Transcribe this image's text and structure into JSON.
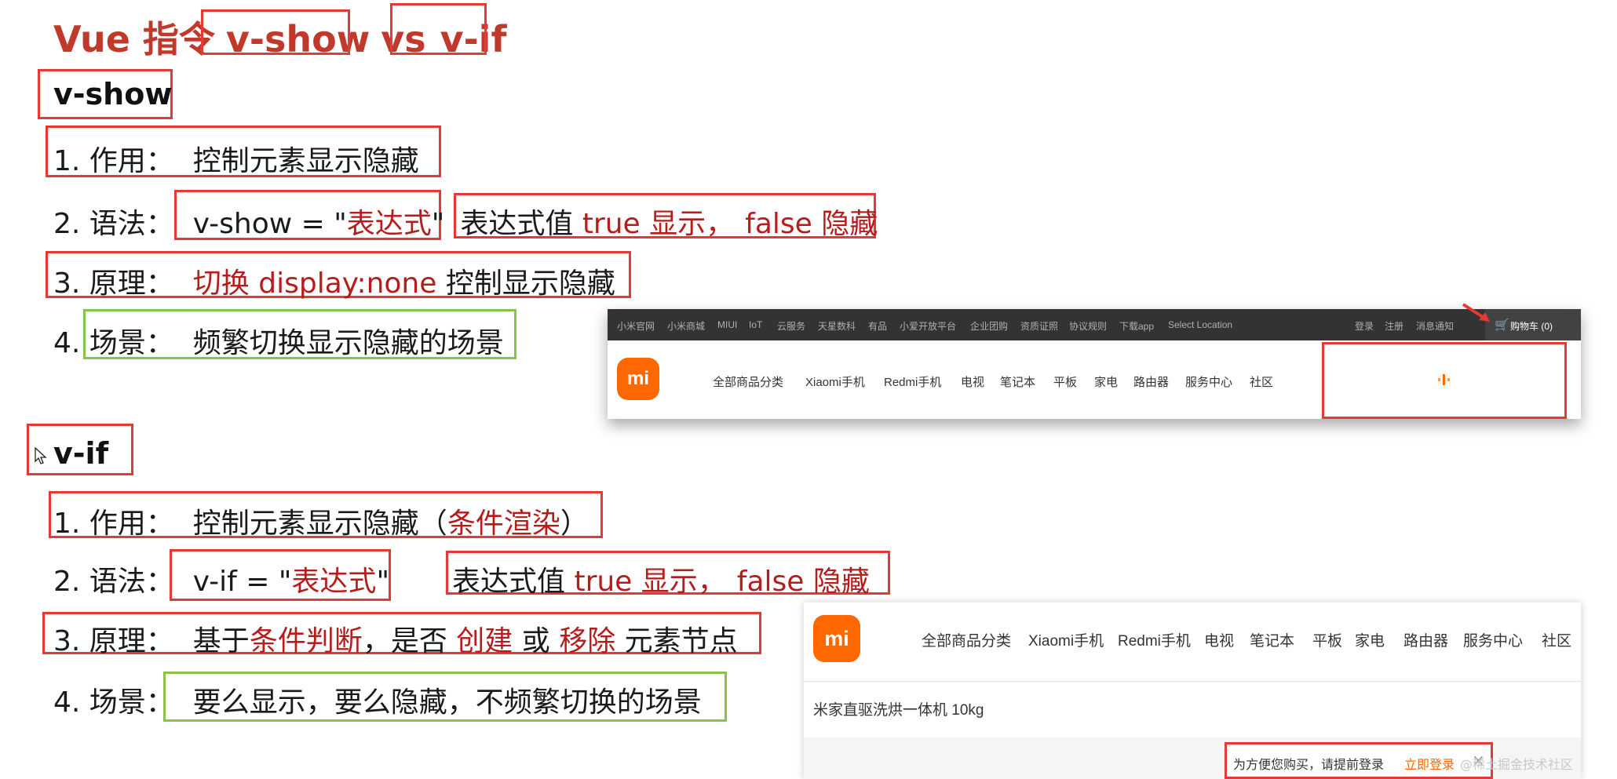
{
  "title": {
    "prefix": "Vue 指令",
    "v_show": "v-show",
    "vs": "vs",
    "v_if": "v-if"
  },
  "vshow": {
    "heading": "v-show",
    "item1": {
      "num": "1. 作用：",
      "text": "控制元素显示隐藏"
    },
    "item2": {
      "num": "2. 语法：",
      "syntax_pre": "v-show = \"",
      "syntax_expr": "表达式",
      "syntax_post": "\"",
      "val_pre": "表达式值 ",
      "val_true": "true 显示，",
      "val_false": "false 隐藏"
    },
    "item3": {
      "num": "3. 原理：",
      "red": "切换 display:none",
      "text": " 控制显示隐藏"
    },
    "item4": {
      "num": "4. 场景：",
      "text": "频繁切换显示隐藏的场景"
    }
  },
  "vif": {
    "heading": "v-if",
    "item1": {
      "num": "1. 作用：",
      "text": "控制元素显示隐藏（",
      "red": "条件渲染",
      "close": "）"
    },
    "item2": {
      "num": "2. 语法：",
      "syntax_pre": "v-if = \"",
      "syntax_expr": "表达式",
      "syntax_post": "\"",
      "val_pre": "表达式值 ",
      "val_true": "true 显示，",
      "val_false": "false 隐藏"
    },
    "item3": {
      "num": "3. 原理：",
      "t1": "基于",
      "r1": "条件判断",
      "t2": "，是否 ",
      "r2": "创建",
      "t3": " 或 ",
      "r3": "移除",
      "t4": " 元素节点"
    },
    "item4": {
      "num": "4. 场景：",
      "text": "要么显示，要么隐藏，不频繁切换的场景"
    }
  },
  "shot1": {
    "topbar": [
      "小米官网",
      "小米商城",
      "MIUI",
      "IoT",
      "云服务",
      "天星数科",
      "有品",
      "小爱开放平台",
      "企业团购",
      "资质证照",
      "协议规则",
      "下载app",
      "Select Location"
    ],
    "topbar_right": [
      "登录",
      "注册",
      "消息通知"
    ],
    "cart": "购物车 (0)",
    "logo": "mi",
    "nav": [
      "全部商品分类",
      "Xiaomi手机",
      "Redmi手机",
      "电视",
      "笔记本",
      "平板",
      "家电",
      "路由器",
      "服务中心",
      "社区"
    ]
  },
  "shot2": {
    "logo": "mi",
    "nav": [
      "全部商品分类",
      "Xiaomi手机",
      "Redmi手机",
      "电视",
      "笔记本",
      "平板",
      "家电",
      "路由器",
      "服务中心",
      "社区"
    ],
    "product": "米家直驱洗烘一体机 10kg",
    "login_tip": "为方便您购买，请提前登录",
    "login_link": "立即登录",
    "close": "×"
  },
  "watermark": "@稀土掘金技术社区",
  "colors": {
    "red_box": "#e53935",
    "green_box": "#8bc34a",
    "title_red": "#c0392b",
    "mi_orange": "#ff6700"
  }
}
